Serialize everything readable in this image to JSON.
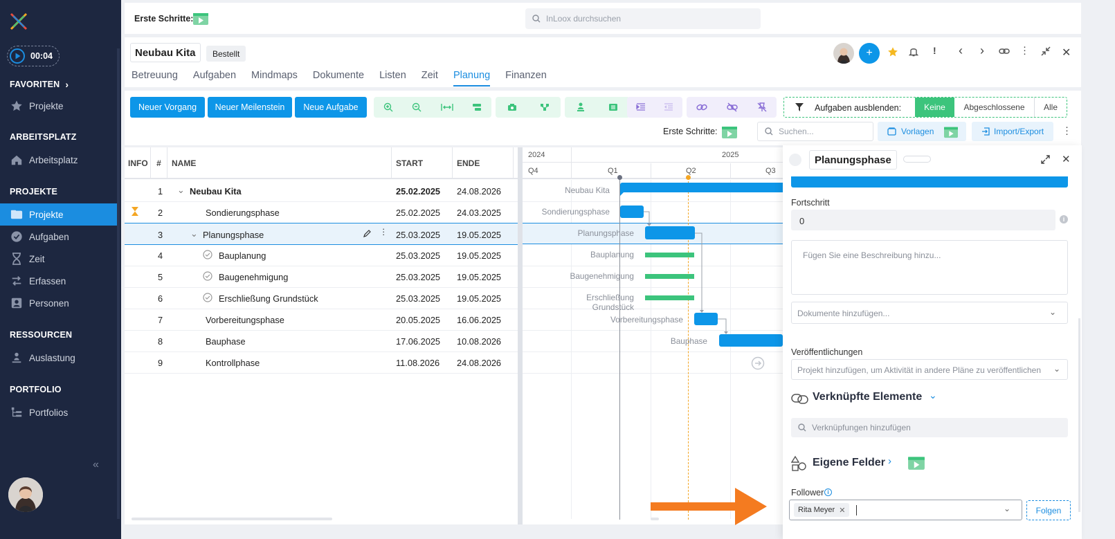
{
  "sidebar": {
    "timer": "00:04",
    "favorites_heading": "FAVORITEN",
    "favorites": [
      {
        "label": "Projekte",
        "icon": "star-icon"
      }
    ],
    "workspace_heading": "ARBEITSPLATZ",
    "workspace": [
      {
        "label": "Arbeitsplatz",
        "icon": "home-icon"
      }
    ],
    "projects_heading": "PROJEKTE",
    "projects": [
      {
        "label": "Projekte",
        "icon": "folder-icon"
      },
      {
        "label": "Aufgaben",
        "icon": "check-circle-icon"
      },
      {
        "label": "Zeit",
        "icon": "hourglass-icon"
      },
      {
        "label": "Erfassen",
        "icon": "swap-icon"
      },
      {
        "label": "Personen",
        "icon": "contact-icon"
      }
    ],
    "resources_heading": "RESSOURCEN",
    "resources": [
      {
        "label": "Auslastung",
        "icon": "person-workload-icon"
      }
    ],
    "portfolio_heading": "PORTFOLIO",
    "portfolio": [
      {
        "label": "Portfolios",
        "icon": "hierarchy-icon"
      }
    ]
  },
  "topbar": {
    "first_steps": "Erste Schritte:",
    "search_placeholder": "InLoox durchsuchen"
  },
  "project": {
    "title": "Neubau Kita",
    "status": "Bestellt",
    "tabs": [
      "Betreuung",
      "Aufgaben",
      "Mindmaps",
      "Dokumente",
      "Listen",
      "Zeit",
      "Planung",
      "Finanzen"
    ],
    "active_tab": "Planung"
  },
  "toolbar": {
    "new_process": "Neuer Vorgang",
    "new_milestone": "Neuer Meilenstein",
    "new_task": "Neue Aufgabe",
    "hide_tasks_label": "Aufgaben ausblenden:",
    "filter_options": [
      "Keine",
      "Abgeschlossene",
      "Alle"
    ],
    "filter_selected": "Keine",
    "first_steps": "Erste Schritte:",
    "search_placeholder": "Suchen...",
    "templates": "Vorlagen",
    "import_export": "Import/Export"
  },
  "table": {
    "headers": {
      "info": "INFO",
      "num": "#",
      "name": "NAME",
      "start": "START",
      "end": "ENDE"
    },
    "rows": [
      {
        "num": "1",
        "name": "Neubau Kita",
        "start": "25.02.2025",
        "end": "24.08.2026"
      },
      {
        "num": "2",
        "name": "Sondierungsphase",
        "start": "25.02.2025",
        "end": "24.03.2025"
      },
      {
        "num": "3",
        "name": "Planungsphase",
        "start": "25.03.2025",
        "end": "19.05.2025"
      },
      {
        "num": "4",
        "name": "Bauplanung",
        "start": "25.03.2025",
        "end": "19.05.2025"
      },
      {
        "num": "5",
        "name": "Baugenehmigung",
        "start": "25.03.2025",
        "end": "19.05.2025"
      },
      {
        "num": "6",
        "name": "Erschließung Grundstück",
        "start": "25.03.2025",
        "end": "19.05.2025"
      },
      {
        "num": "7",
        "name": "Vorbereitungsphase",
        "start": "20.05.2025",
        "end": "16.06.2025"
      },
      {
        "num": "8",
        "name": "Bauphase",
        "start": "17.06.2025",
        "end": "10.08.2026"
      },
      {
        "num": "9",
        "name": "Kontrollphase",
        "start": "11.08.2026",
        "end": "24.08.2026"
      }
    ]
  },
  "gantt": {
    "years": [
      "2024",
      "2025"
    ],
    "quarters": [
      "Q4",
      "Q1",
      "Q2",
      "Q3"
    ]
  },
  "panel": {
    "title": "Planungsphase",
    "progress_label": "Fortschritt",
    "progress_value": "0",
    "description_placeholder": "Fügen Sie eine Beschreibung hinzu...",
    "documents_placeholder": "Dokumente hinzufügen...",
    "publications_label": "Veröffentlichungen",
    "publications_placeholder": "Projekt hinzufügen, um Aktivität in andere Pläne zu veröffentlichen",
    "linked_heading": "Verknüpfte Elemente",
    "links_placeholder": "Verknüpfungen hinzufügen",
    "custom_fields_heading": "Eigene Felder",
    "follower_label": "Follower",
    "follower_chip": "Rita Meyer",
    "follow_button": "Folgen"
  },
  "colors": {
    "sidebar": "#1d2740",
    "accent": "#0d96e8",
    "green": "#3cc47c",
    "arrow": "#f47b20"
  }
}
